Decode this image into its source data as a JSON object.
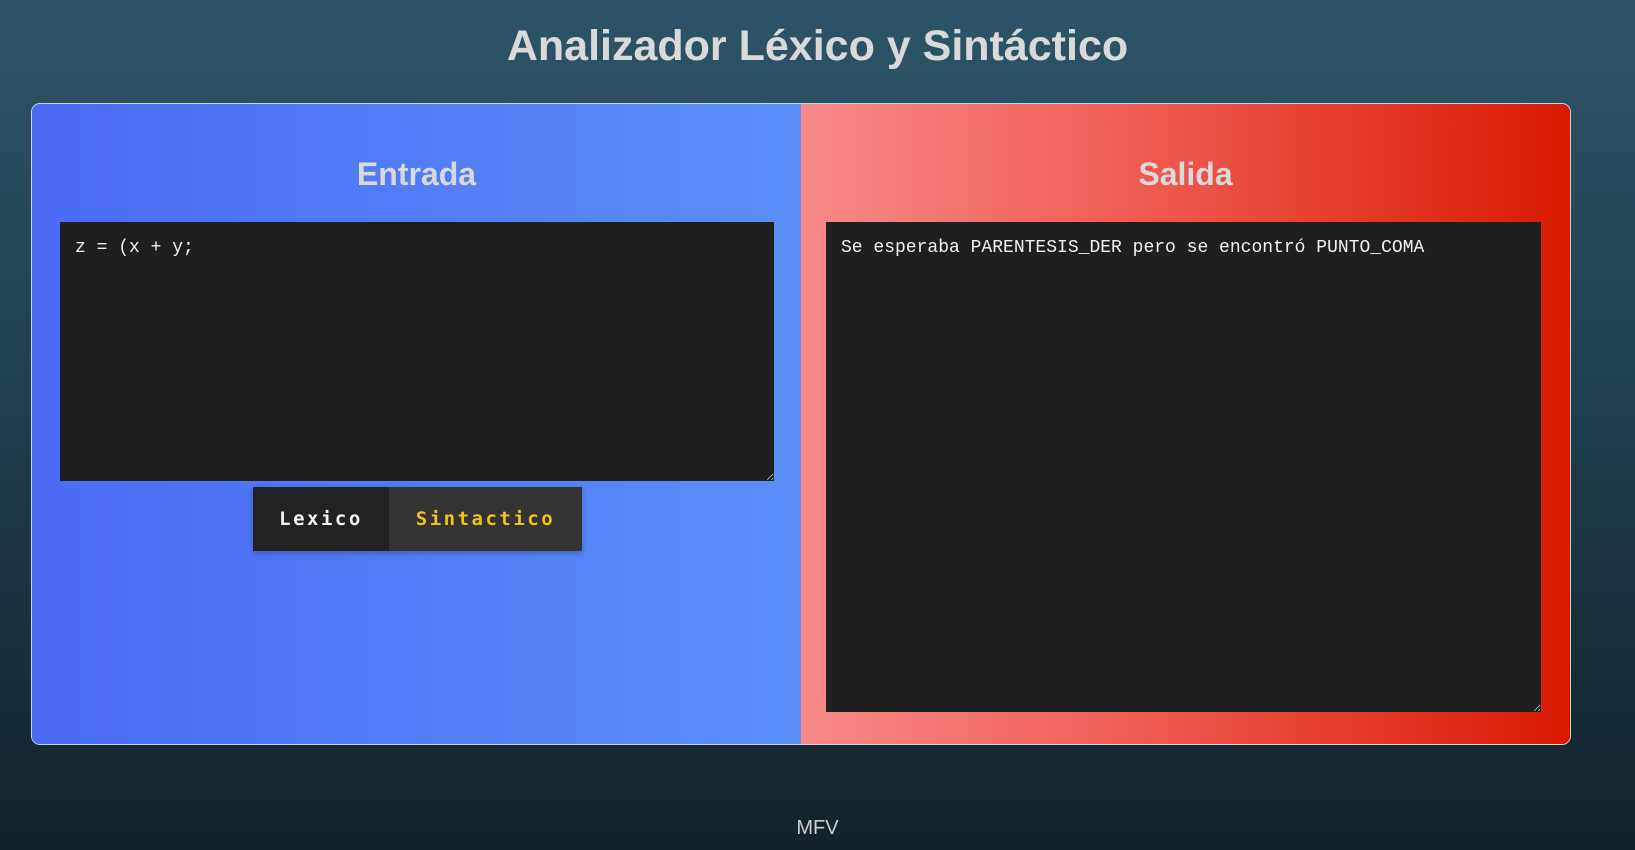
{
  "header": {
    "title": "Analizador Léxico y Sintáctico"
  },
  "input_panel": {
    "title": "Entrada",
    "code": "z = (x + y;",
    "gradient_colors": [
      "#4a6bf6",
      "#5b8ff8"
    ]
  },
  "output_panel": {
    "title": "Salida",
    "message": "Se esperaba PARENTESIS_DER pero se encontró PUNTO_COMA",
    "gradient_colors": [
      "#f88a8a",
      "#d91a02"
    ]
  },
  "buttons": {
    "lexico_label": "Lexico",
    "sintactico_label": "Sintactico",
    "sintactico_color": "#f2c21b"
  },
  "footer": {
    "text": "MFV"
  }
}
